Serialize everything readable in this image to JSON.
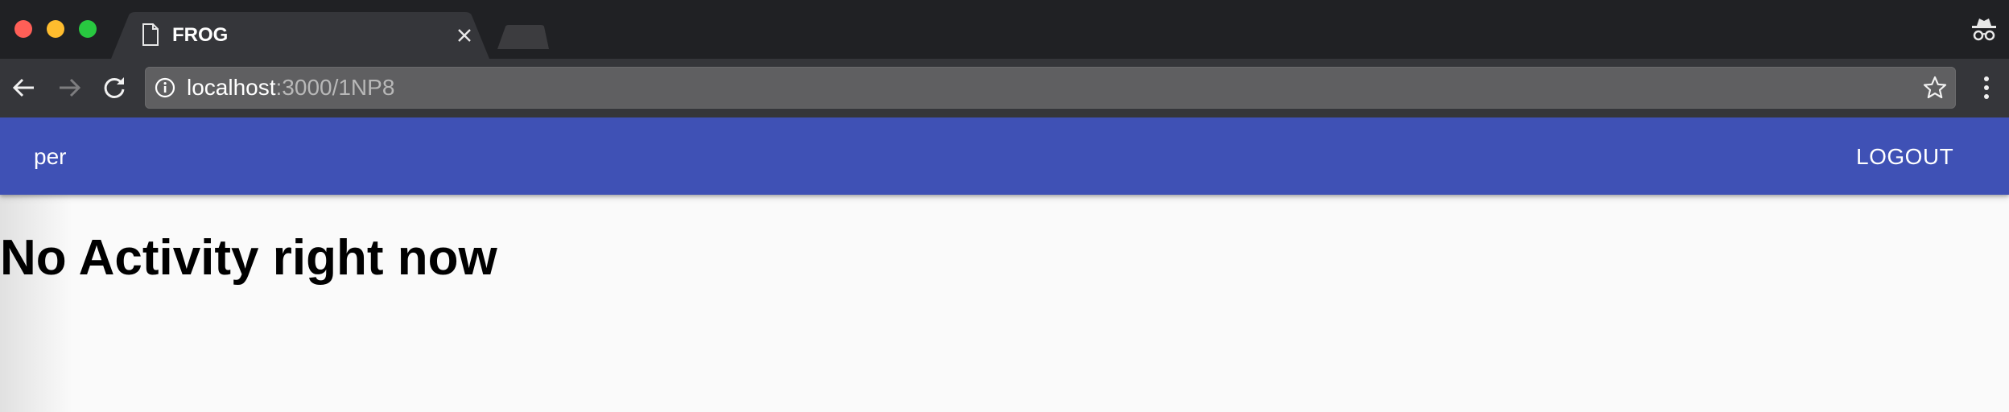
{
  "browser": {
    "tab": {
      "title": "FROG",
      "icon": "file-icon",
      "close_icon": "close-icon"
    },
    "address_bar": {
      "host": "localhost",
      "path": ":3000/1NP8",
      "info_icon": "info-icon"
    },
    "nav_icons": [
      "back-arrow-icon",
      "forward-arrow-icon",
      "reload-icon"
    ],
    "right_icons": [
      "star-icon",
      "kebab-menu-icon"
    ],
    "incognito_icon": "incognito-icon",
    "colors": {
      "tabstrip": "#202124",
      "toolbar": "#35363a",
      "omnibox": "#5f5f61"
    }
  },
  "app": {
    "appbar": {
      "user_name": "per",
      "logout_label": "LOGOUT",
      "color": "#3f51b5"
    },
    "main": {
      "heading": "No Activity right now"
    }
  }
}
